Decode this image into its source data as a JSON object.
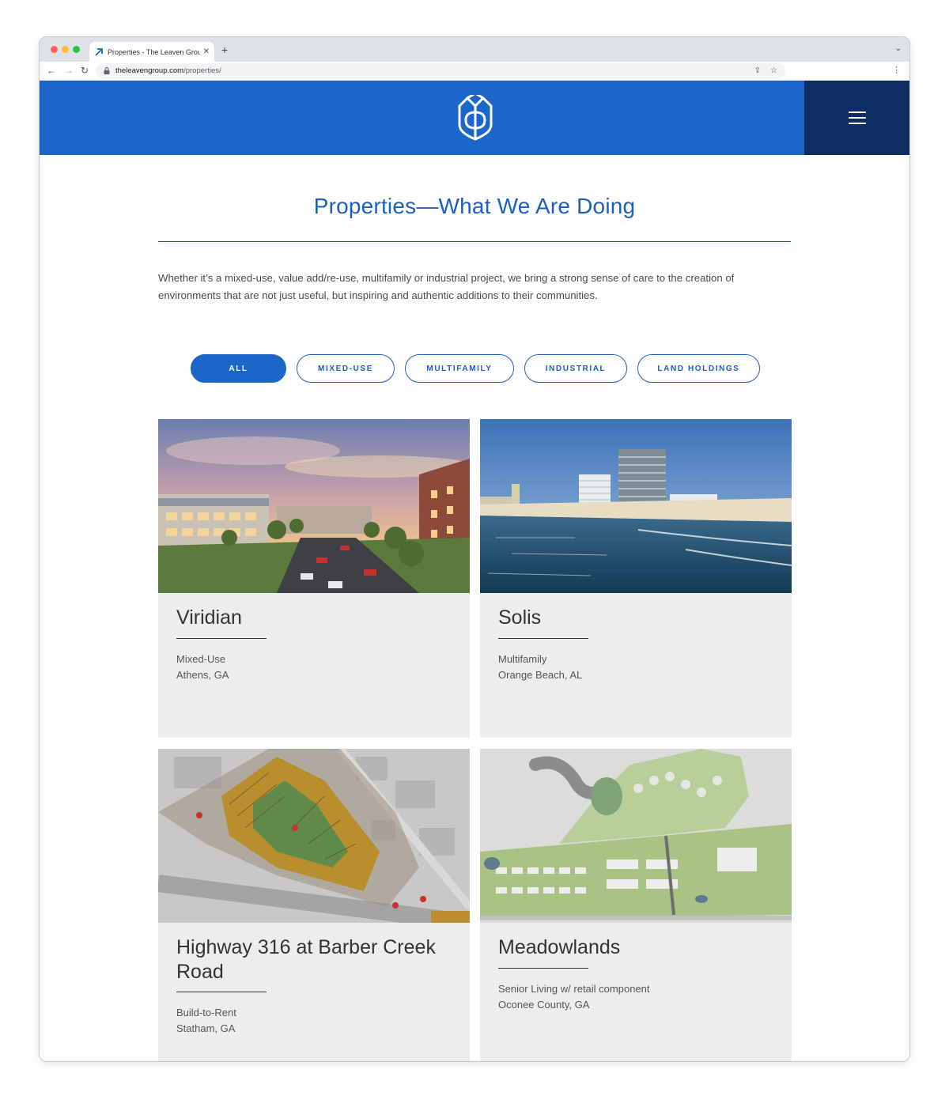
{
  "browser": {
    "tab_title": "Properties - The Leaven Group",
    "url_host": "theleavengroup.com",
    "url_path": "/properties/"
  },
  "colors": {
    "brand_blue": "#1b66c9",
    "menu_navy": "#0d2d63",
    "card_bg": "#ededee"
  },
  "header": {
    "logo_icon": "leaven-group-logo-icon",
    "menu_icon": "hamburger-menu-icon"
  },
  "main": {
    "title": "Properties—What We Are Doing",
    "intro_line1": "Whether it’s a mixed-use, value add/re-use, multifamily or industrial project, we bring a strong sense of care to the creation of",
    "intro_line2": "environments that are not just useful, but inspiring and authentic additions to their communities."
  },
  "filters": [
    {
      "label": "ALL",
      "active": true
    },
    {
      "label": "MIXED-USE",
      "active": false
    },
    {
      "label": "MULTIFAMILY",
      "active": false
    },
    {
      "label": "INDUSTRIAL",
      "active": false
    },
    {
      "label": "LAND HOLDINGS",
      "active": false
    }
  ],
  "properties": [
    {
      "name": "Viridian",
      "type": "Mixed-Use",
      "location": "Athens, GA"
    },
    {
      "name": "Solis",
      "type": "Multifamily",
      "location": "Orange Beach, AL"
    },
    {
      "name": "Highway 316 at Barber Creek Road",
      "name_line1": "Highway 316 at Barber Creek",
      "name_line2": "Road",
      "type": "Build-to-Rent",
      "location": "Statham, GA"
    },
    {
      "name": "Meadowlands",
      "type": "Senior Living w/ retail component",
      "location": "Oconee County, GA"
    }
  ]
}
